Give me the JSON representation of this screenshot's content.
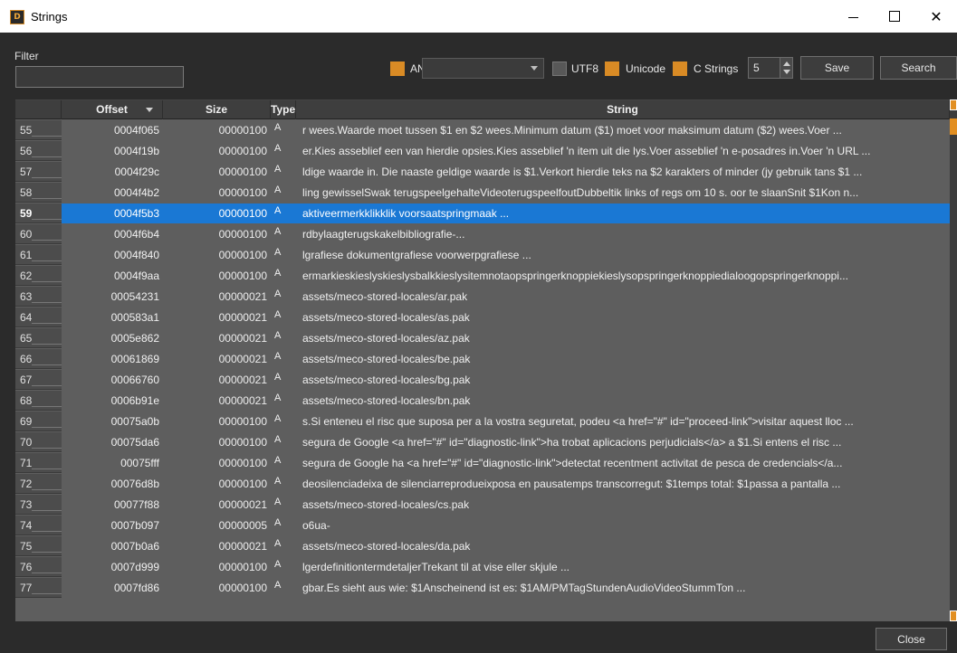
{
  "window": {
    "title": "Strings",
    "app_icon_text": "D"
  },
  "toolbar": {
    "filter_label": "Filter",
    "filter_value": "",
    "ansi_label": "ANSI",
    "ansi_checked": true,
    "encoding_value": "",
    "utf8_label": "UTF8",
    "utf8_checked": false,
    "unicode_label": "Unicode",
    "unicode_checked": true,
    "cstrings_label": "C Strings",
    "cstrings_checked": true,
    "min_length": "5",
    "save_label": "Save",
    "search_label": "Search"
  },
  "table": {
    "columns": [
      "Offset",
      "Size",
      "Type",
      "String"
    ],
    "selected_row": "59",
    "rows": [
      {
        "n": "55",
        "offset": "0004f065",
        "size": "00000100",
        "type": "A",
        "string": "r wees.Waarde moet tussen $1 en $2 wees.Minimum datum ($1) moet voor maksimum datum ($2) wees.Voer ..."
      },
      {
        "n": "56",
        "offset": "0004f19b",
        "size": "00000100",
        "type": "A",
        "string": "er.Kies asseblief een van hierdie opsies.Kies asseblief 'n item uit die lys.Voer asseblief 'n e-posadres in.Voer 'n URL ..."
      },
      {
        "n": "57",
        "offset": "0004f29c",
        "size": "00000100",
        "type": "A",
        "string": "ldige waarde in. Die naaste geldige waarde is $1.Verkort hierdie teks na $2 karakters of minder (jy gebruik tans $1 ..."
      },
      {
        "n": "58",
        "offset": "0004f4b2",
        "size": "00000100",
        "type": "A",
        "string": "ling gewisselSwak terugspeelgehalteVideoterugspeelfoutDubbeltik links of regs om 10 s. oor te slaanSnit $1Kon n..."
      },
      {
        "n": "59",
        "offset": "0004f5b3",
        "size": "00000100",
        "type": "A",
        "string": "aktiveermerkklikklik voorsaatspringmaak ..."
      },
      {
        "n": "60",
        "offset": "0004f6b4",
        "size": "00000100",
        "type": "A",
        "string": "rdbylaagterugskakelbibliografie-..."
      },
      {
        "n": "61",
        "offset": "0004f840",
        "size": "00000100",
        "type": "A",
        "string": "lgrafiese dokumentgrafiese voorwerpgrafiese ..."
      },
      {
        "n": "62",
        "offset": "0004f9aa",
        "size": "00000100",
        "type": "A",
        "string": "ermarkieskieslyskieslysbalkkieslysitemnotaopspringerknoppiekieslysopspringerknoppiedialoogopspringerknoppi..."
      },
      {
        "n": "63",
        "offset": "00054231",
        "size": "00000021",
        "type": "A",
        "string": "assets/meco-stored-locales/ar.pak"
      },
      {
        "n": "64",
        "offset": "000583a1",
        "size": "00000021",
        "type": "A",
        "string": "assets/meco-stored-locales/as.pak"
      },
      {
        "n": "65",
        "offset": "0005e862",
        "size": "00000021",
        "type": "A",
        "string": "assets/meco-stored-locales/az.pak"
      },
      {
        "n": "66",
        "offset": "00061869",
        "size": "00000021",
        "type": "A",
        "string": "assets/meco-stored-locales/be.pak"
      },
      {
        "n": "67",
        "offset": "00066760",
        "size": "00000021",
        "type": "A",
        "string": "assets/meco-stored-locales/bg.pak"
      },
      {
        "n": "68",
        "offset": "0006b91e",
        "size": "00000021",
        "type": "A",
        "string": "assets/meco-stored-locales/bn.pak"
      },
      {
        "n": "69",
        "offset": "00075a0b",
        "size": "00000100",
        "type": "A",
        "string": "s.Si enteneu el risc que suposa per a la vostra seguretat, podeu <a href=\"#\" id=\"proceed-link\">visitar aquest lloc ..."
      },
      {
        "n": "70",
        "offset": "00075da6",
        "size": "00000100",
        "type": "A",
        "string": " segura de Google <a href=\"#\" id=\"diagnostic-link\">ha trobat aplicacions perjudicials</a> a $1.Si entens el risc ..."
      },
      {
        "n": "71",
        "offset": "00075fff",
        "size": "00000100",
        "type": "A",
        "string": " segura de Google ha <a href=\"#\" id=\"diagnostic-link\">detectat recentment activitat de pesca de credencials</a..."
      },
      {
        "n": "72",
        "offset": "00076d8b",
        "size": "00000100",
        "type": "A",
        "string": "deosilenciadeixa de silenciarreprodueixposa en pausatemps transcorregut: $1temps total: $1passa a pantalla ..."
      },
      {
        "n": "73",
        "offset": "00077f88",
        "size": "00000021",
        "type": "A",
        "string": "assets/meco-stored-locales/cs.pak"
      },
      {
        "n": "74",
        "offset": "0007b097",
        "size": "00000005",
        "type": "A",
        "string": "o6ua-"
      },
      {
        "n": "75",
        "offset": "0007b0a6",
        "size": "00000021",
        "type": "A",
        "string": "assets/meco-stored-locales/da.pak"
      },
      {
        "n": "76",
        "offset": "0007d999",
        "size": "00000100",
        "type": "A",
        "string": "lgerdefinitiontermdetaljerTrekant til at vise eller skjule ..."
      },
      {
        "n": "77",
        "offset": "0007fd86",
        "size": "00000100",
        "type": "A",
        "string": "gbar.Es sieht aus wie: $1Anscheinend ist es: $1AM/PMTagStundenAudioVideoStummTon ..."
      }
    ]
  },
  "footer": {
    "close_label": "Close"
  },
  "colors": {
    "accent_orange": "#d98b25",
    "selection_blue": "#1a78d4",
    "grid_bg": "#5e5e5e",
    "window_bg": "#2b2b2b"
  }
}
